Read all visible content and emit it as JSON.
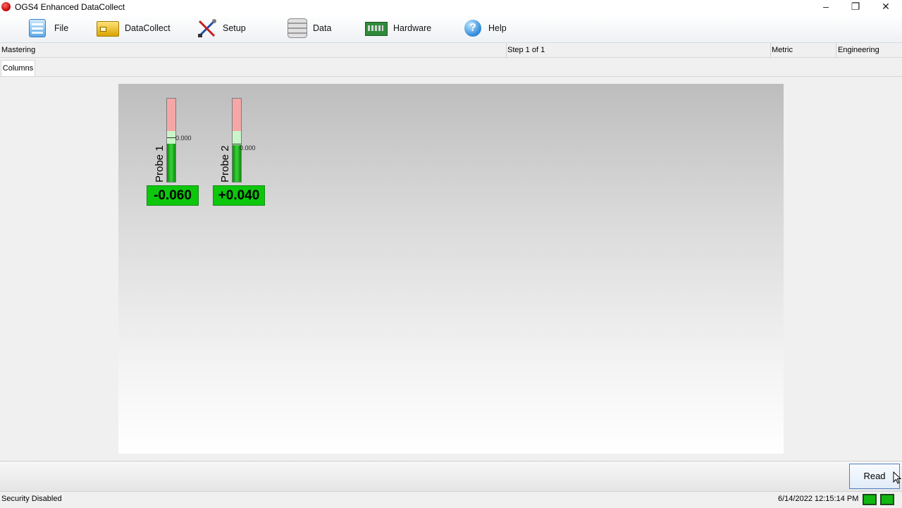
{
  "window": {
    "title": "OGS4 Enhanced DataCollect"
  },
  "toolbar": {
    "items": [
      {
        "label": "File",
        "icon": "file-icon"
      },
      {
        "label": "DataCollect",
        "icon": "datacollect-icon"
      },
      {
        "label": "Setup",
        "icon": "setup-icon"
      },
      {
        "label": "Data",
        "icon": "data-icon"
      },
      {
        "label": "Hardware",
        "icon": "hardware-icon"
      },
      {
        "label": "Help",
        "icon": "help-icon"
      }
    ]
  },
  "info": {
    "mode": "Mastering",
    "step": "Step 1 of 1",
    "units": "Metric",
    "user": "Engineering"
  },
  "tabs": [
    {
      "label": "Columns"
    }
  ],
  "probes": [
    {
      "name": "Probe 1",
      "zero_label": "0.000",
      "value": "-0.060"
    },
    {
      "name": "Probe 2",
      "zero_label": "0.000",
      "value": "+0.040"
    }
  ],
  "actions": {
    "read_label": "Read"
  },
  "status": {
    "security": "Security Disabled",
    "datetime": "6/14/2022 12:15:14 PM"
  },
  "colors": {
    "value_ok": "#0cc70c",
    "bar_tolerance": "#f5a7a7",
    "bar_fill": "#2fbf2f"
  }
}
